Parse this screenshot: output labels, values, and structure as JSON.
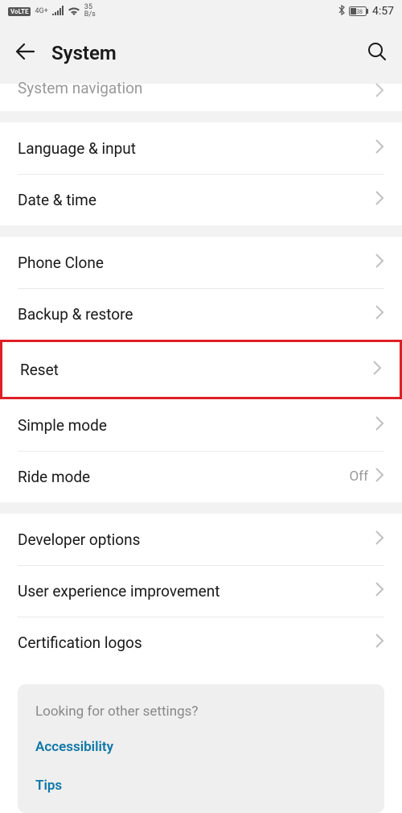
{
  "statusbar": {
    "volte": "VoLTE",
    "network_gen": "4G+",
    "speed_value": "35",
    "speed_unit": "B/s",
    "battery": "38",
    "time": "4:57"
  },
  "header": {
    "title": "System"
  },
  "partial": {
    "label": "System navigation"
  },
  "groups": [
    {
      "items": [
        {
          "label": "Language & input"
        },
        {
          "label": "Date & time"
        }
      ]
    },
    {
      "items": [
        {
          "label": "Phone Clone"
        },
        {
          "label": "Backup & restore"
        }
      ],
      "highlighted_after": {
        "label": "Reset"
      }
    },
    {
      "items": [
        {
          "label": "Simple mode"
        },
        {
          "label": "Ride mode",
          "value": "Off"
        }
      ]
    },
    {
      "items": [
        {
          "label": "Developer options"
        },
        {
          "label": "User experience improvement"
        },
        {
          "label": "Certification logos"
        }
      ]
    }
  ],
  "footer": {
    "prompt": "Looking for other settings?",
    "links": [
      "Accessibility",
      "Tips"
    ]
  }
}
